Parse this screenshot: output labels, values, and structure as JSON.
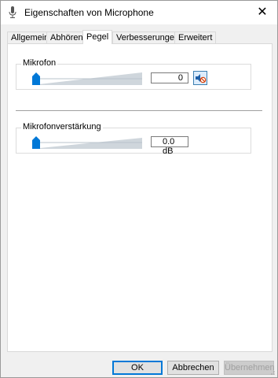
{
  "window": {
    "title": "Eigenschaften von Microphone"
  },
  "tabs": [
    {
      "label": "Allgemein",
      "active": false
    },
    {
      "label": "Abhören",
      "active": false
    },
    {
      "label": "Pegel",
      "active": true
    },
    {
      "label": "Verbesserungen",
      "active": false
    },
    {
      "label": "Erweitert",
      "active": false
    }
  ],
  "microphone": {
    "group_label": "Mikrofon",
    "level_value": "0",
    "level_fraction": 0.0,
    "muted": true
  },
  "boost": {
    "group_label": "Mikrofonverstärkung",
    "value": "0.0 dB",
    "level_fraction": 0.0
  },
  "buttons": {
    "ok": "OK",
    "cancel": "Abbrechen",
    "apply": "Übernehmen"
  },
  "colors": {
    "accent": "#0078d7",
    "mute_red": "#d83b01"
  }
}
